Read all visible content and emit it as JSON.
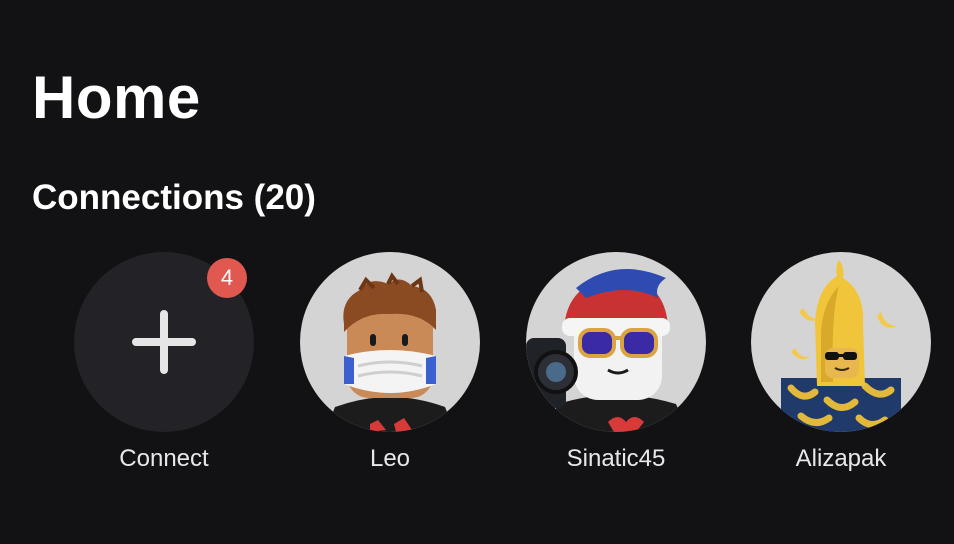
{
  "page": {
    "title": "Home"
  },
  "connections": {
    "header": "Connections (20)",
    "connect_tile": {
      "label": "Connect",
      "badge_count": "4",
      "icon": "plus-icon"
    },
    "friends": [
      {
        "name": "Leo",
        "avatar": "avatar-face-mask-brown-hair"
      },
      {
        "name": "Sinatic45",
        "avatar": "avatar-beanie-sunglasses-camera"
      },
      {
        "name": "Alizapak",
        "avatar": "avatar-banana-costume"
      }
    ]
  },
  "colors": {
    "background": "#121214",
    "connect_circle": "#232327",
    "avatar_background": "#d4d4d4",
    "badge": "#e0584f",
    "text": "#ffffff"
  }
}
